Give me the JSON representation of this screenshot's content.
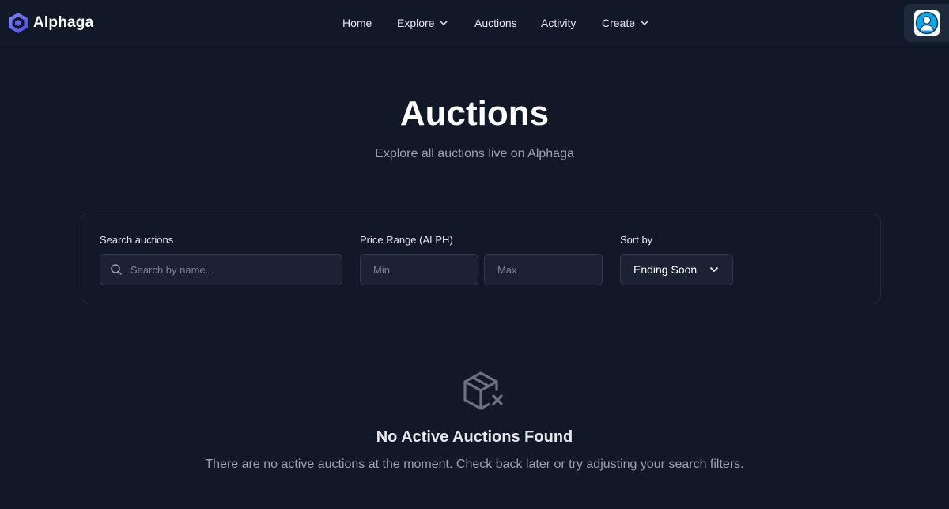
{
  "app": {
    "name": "Alphaga"
  },
  "nav": {
    "home": "Home",
    "explore": "Explore",
    "auctions": "Auctions",
    "activity": "Activity",
    "create": "Create"
  },
  "page": {
    "title": "Auctions",
    "subtitle": "Explore all auctions live on Alphaga"
  },
  "filters": {
    "search_label": "Search auctions",
    "search_placeholder": "Search by name...",
    "price_label": "Price Range (ALPH)",
    "min_placeholder": "Min",
    "max_placeholder": "Max",
    "sort_label": "Sort by",
    "sort_value": "Ending Soon"
  },
  "empty_state": {
    "icon": "package-x-icon",
    "title": "No Active Auctions Found",
    "message": "There are no active auctions at the moment. Check back later or try adjusting your search filters."
  },
  "colors": {
    "background": "#111827",
    "accent": "#4f46e5",
    "muted_text": "#9ca3af"
  }
}
